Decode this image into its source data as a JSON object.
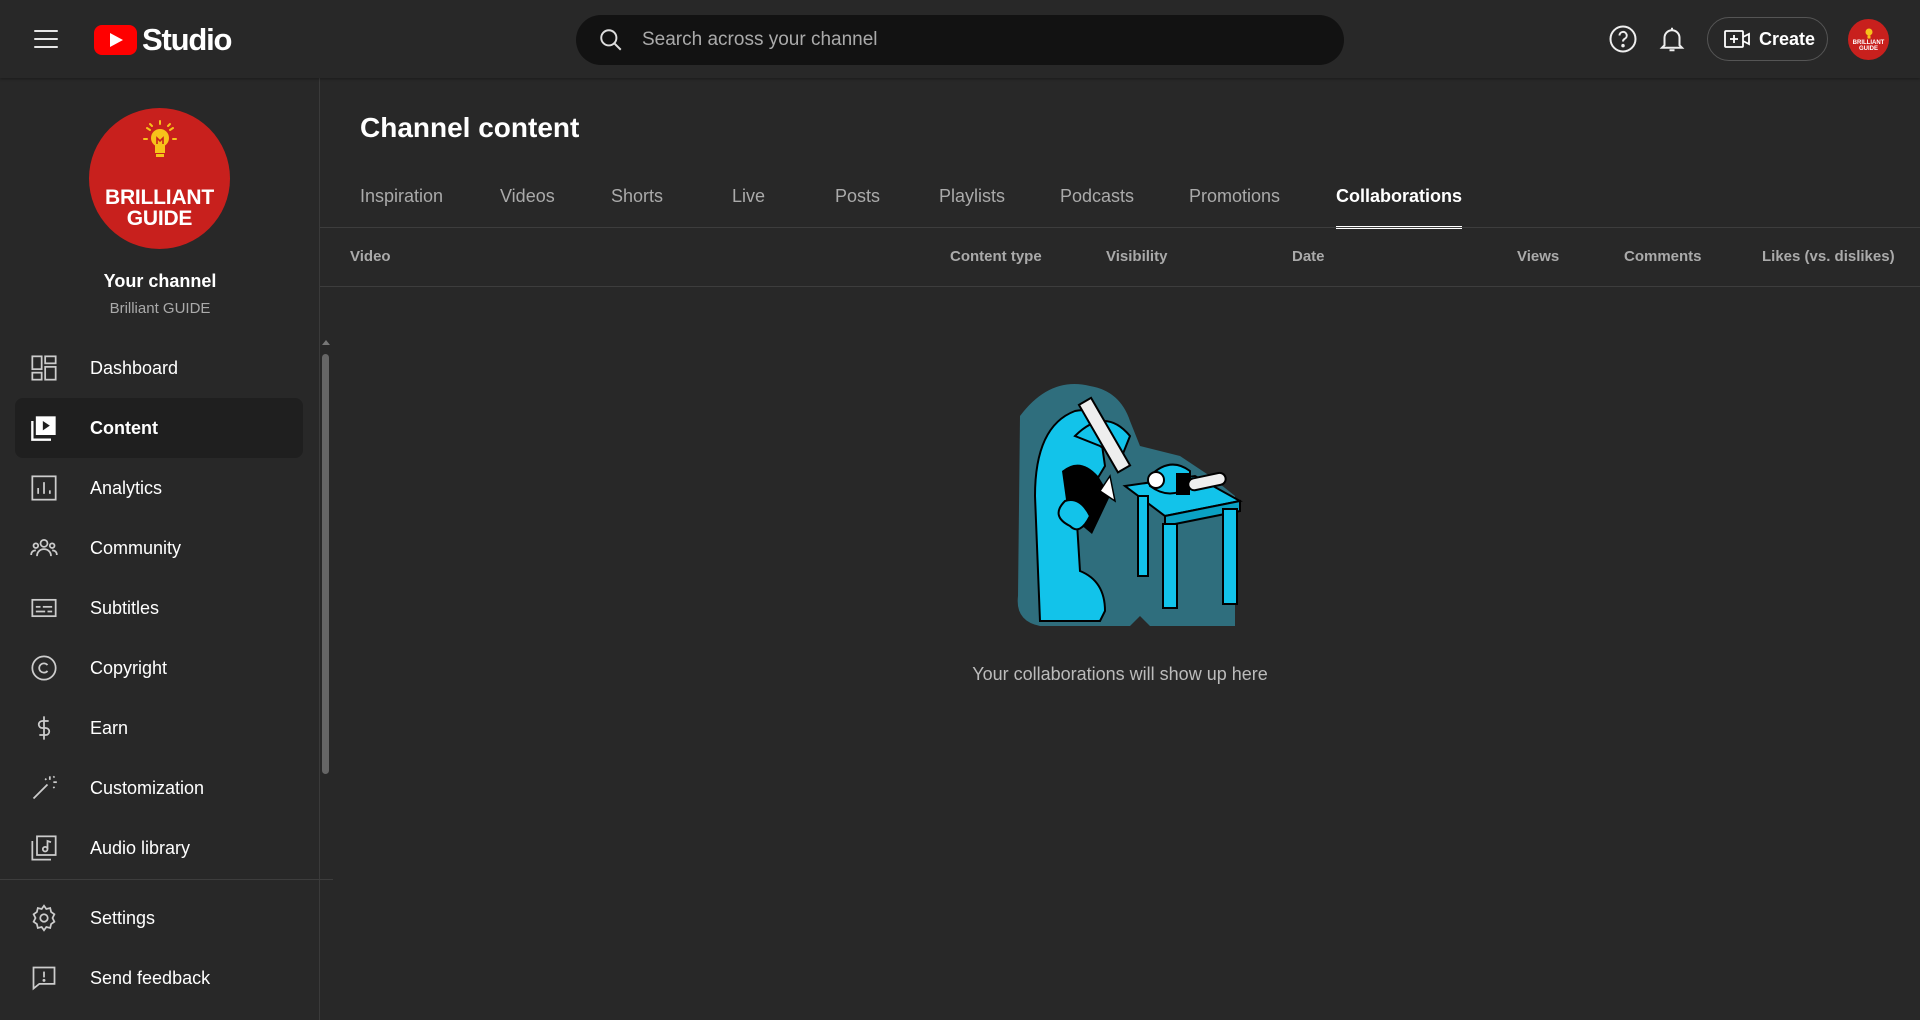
{
  "topbar": {
    "logo_text": "Studio",
    "search_placeholder": "Search across your channel",
    "create_label": "Create"
  },
  "channel": {
    "avatar_text_line1": "BRILLIANT",
    "avatar_text_line2": "GUIDE",
    "your_channel_label": "Your channel",
    "name": "Brilliant GUIDE"
  },
  "sidebar": {
    "items": [
      {
        "label": "Dashboard",
        "icon": "dashboard-icon"
      },
      {
        "label": "Content",
        "icon": "content-icon",
        "active": true
      },
      {
        "label": "Analytics",
        "icon": "analytics-icon"
      },
      {
        "label": "Community",
        "icon": "community-icon"
      },
      {
        "label": "Subtitles",
        "icon": "subtitles-icon"
      },
      {
        "label": "Copyright",
        "icon": "copyright-icon"
      },
      {
        "label": "Earn",
        "icon": "earn-icon"
      },
      {
        "label": "Customization",
        "icon": "customization-icon"
      },
      {
        "label": "Audio library",
        "icon": "audio-library-icon"
      }
    ],
    "bottom_items": [
      {
        "label": "Settings",
        "icon": "settings-icon"
      },
      {
        "label": "Send feedback",
        "icon": "feedback-icon"
      }
    ]
  },
  "main": {
    "title": "Channel content",
    "tabs": [
      {
        "label": "Inspiration"
      },
      {
        "label": "Videos"
      },
      {
        "label": "Shorts"
      },
      {
        "label": "Live"
      },
      {
        "label": "Posts"
      },
      {
        "label": "Playlists"
      },
      {
        "label": "Podcasts"
      },
      {
        "label": "Promotions"
      },
      {
        "label": "Collaborations",
        "active": true
      }
    ],
    "columns": [
      "Video",
      "Content type",
      "Visibility",
      "Date",
      "Views",
      "Comments",
      "Likes (vs. dislikes)"
    ],
    "empty_message": "Your collaborations will show up here"
  },
  "colors": {
    "background": "#282828",
    "accent_red": "#ff0000",
    "illustration_cyan": "#12c3ea",
    "illustration_backdrop": "#2f6e7d"
  }
}
